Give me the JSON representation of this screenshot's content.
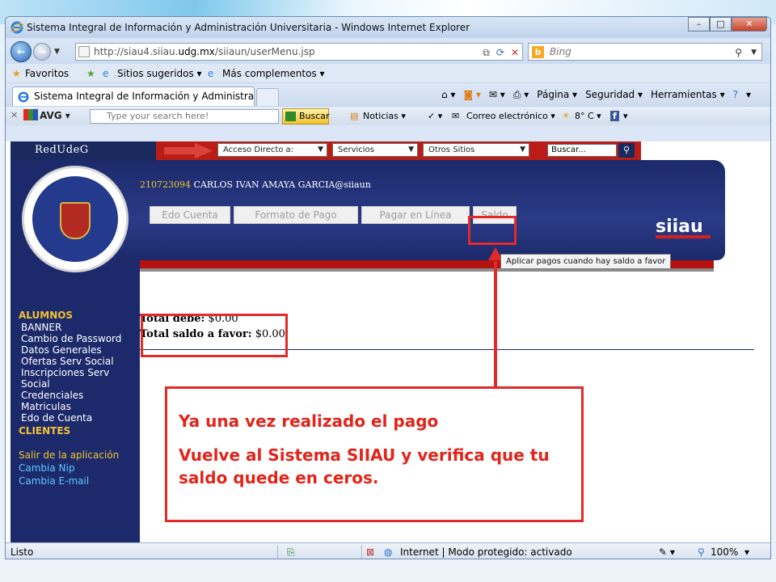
{
  "browser": {
    "title": "Sistema Integral de Información y Administración Universitaria - Windows Internet Explorer",
    "url_prefix": "http://siau4.siiau.",
    "url_domain": "udg.mx",
    "url_path": "/siiaun/userMenu.jsp",
    "search_placeholder": "Bing",
    "favorites": {
      "label": "Favoritos",
      "suggested": "Sitios sugeridos ▾",
      "more": "Más complementos ▾"
    },
    "tab_label": "Sistema Integral de Información y Administració...",
    "commands": [
      "Página ▾",
      "Seguridad ▾",
      "Herramientas ▾",
      "▾"
    ]
  },
  "avg_toolbar": {
    "logo": "AVG",
    "search_placeholder": "Type your search here!",
    "search_button": "Buscar",
    "news": "Noticias ▾",
    "email": "Correo electrónico ▾",
    "weather": "8° C ▾"
  },
  "udg_bar": {
    "brand": "RedUdeG",
    "select_direct": "Acceso Directo a:",
    "select_services": "Servicios",
    "select_other": "Otros Sitios",
    "search_placeholder": "Buscar..."
  },
  "siiau": {
    "user_id": "210723094",
    "user_name": "CARLOS IVAN AMAYA GARCIA@siiaun",
    "menu": [
      "Edo Cuenta",
      "Formato de Pago",
      "Pagar en Línea",
      "Saldo"
    ],
    "logo": "siiau",
    "tooltip": "Aplicar pagos cuando hay saldo a favor"
  },
  "sidebar": {
    "alumnos_header": "ALUMNOS",
    "alumnos_items": [
      "BANNER",
      "Cambio de Password",
      "Datos Generales",
      "Ofertas Serv Social",
      "Inscripciones Serv",
      "Social",
      "Credenciales",
      "Matriculas",
      "Edo de Cuenta"
    ],
    "clientes_header": "CLIENTES",
    "links": [
      "Salir de la aplicación",
      "Cambia Nip",
      "Cambia E-mail"
    ]
  },
  "totals": {
    "debe_label": "Total debe:",
    "debe_value": "$0.00",
    "favor_label": "Total saldo a favor:",
    "favor_value": "$0.00"
  },
  "callout": {
    "line1": "Ya una vez realizado el pago",
    "line2": "Vuelve al Sistema SIIAU y verifica que tu saldo quede en ceros."
  },
  "status": {
    "left": "Listo",
    "zone": "Internet | Modo protegido: activado",
    "zoom": "100%"
  }
}
